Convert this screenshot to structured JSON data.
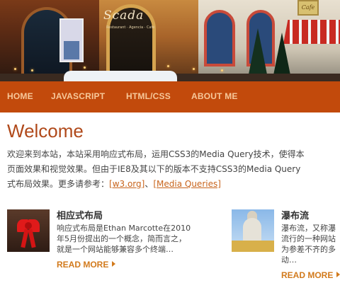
{
  "banner": {
    "sign_text": "Scada",
    "sign_subtext": "Restaurant · Agencia · Café",
    "plaque_text": "Cafe"
  },
  "nav": {
    "items": [
      {
        "label": "HOME"
      },
      {
        "label": "JAVASCRIPT"
      },
      {
        "label": "HTML/CSS"
      },
      {
        "label": "ABOUT ME"
      }
    ]
  },
  "main": {
    "title": "Welcome",
    "intro": {
      "line1": "欢迎来到本站，本站采用响应式布局，运用CSS3的Media Query技术，使得本",
      "line2": "页面效果和视觉效果。但由于IE8及其以下的版本不支持CSS3的Media Query",
      "line3_prefix": "式布局效果。更多请参考：",
      "link1": "[w3.org]",
      "separator": "、",
      "link2": "[Media Queries]"
    }
  },
  "cards": [
    {
      "title": "相应式布局",
      "lines": [
        "响应式布局是Ethan Marcotte在2010",
        "年5月份提出的一个概念，简而言之，",
        "就是一个网站能够兼容多个终端…"
      ],
      "more": "READ MORE",
      "image_icon": "christmas-bow-image"
    },
    {
      "title": "瀑布流",
      "lines": [
        "瀑布流，又称瀑",
        "流行的一种网站",
        "为参差不齐的多",
        "动…"
      ],
      "more": "READ MORE",
      "image_icon": "tower-image"
    }
  ],
  "colors": {
    "nav_bg": "#c24a0c",
    "nav_text": "#f7c89a",
    "title": "#b0491a",
    "link": "#c8641c",
    "read_more": "#d27a1c"
  }
}
